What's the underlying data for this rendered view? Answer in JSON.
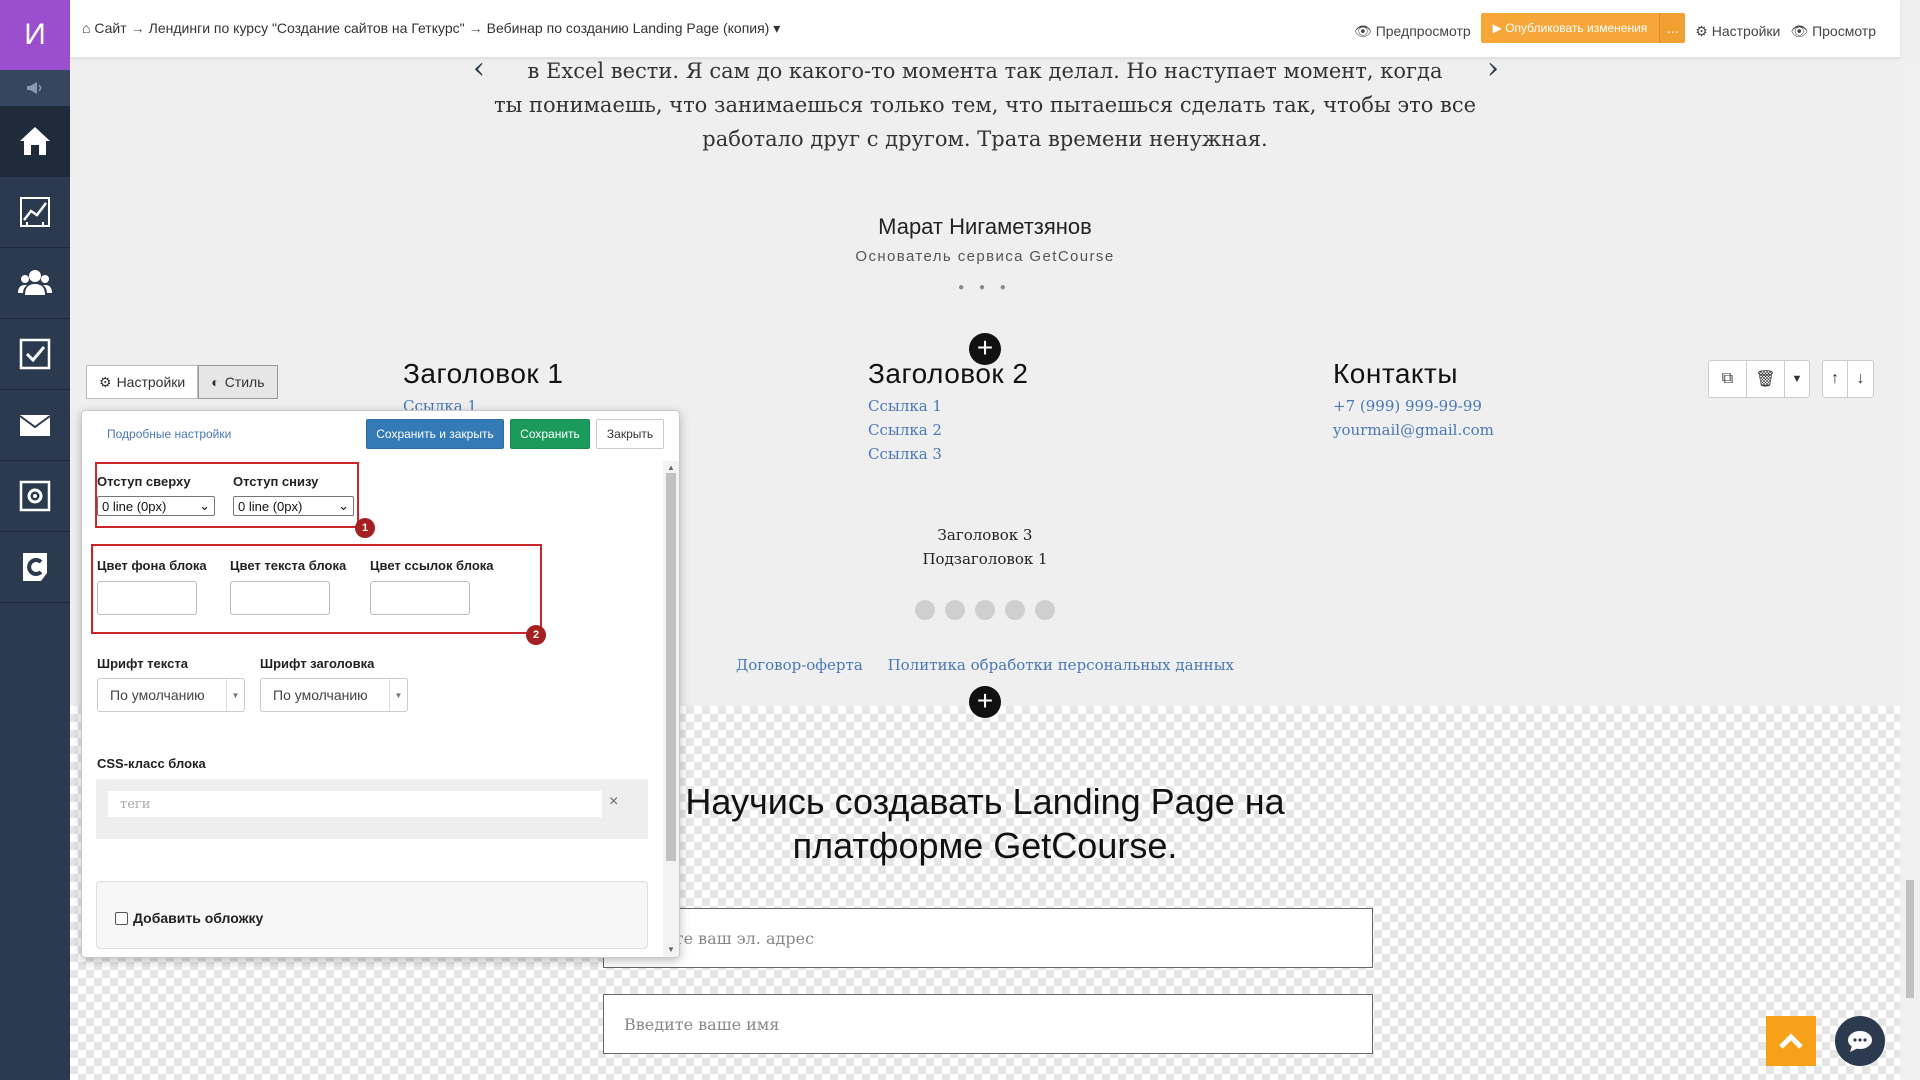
{
  "sidebar": {
    "logo_letter": "И",
    "items": [
      "home",
      "analytics",
      "users",
      "tasks",
      "messages",
      "settings",
      "getcourse"
    ]
  },
  "topbar": {
    "breadcrumb": [
      "Сайт",
      "Лендинги по курсу \"Создание сайтов на Геткурс\"",
      "Вебинар по созданию Landing Page (копия)"
    ],
    "preview": "Предпросмотр",
    "publish": "Опубликовать изменения",
    "publish_more": "...",
    "settings": "Настройки",
    "view": "Просмотр"
  },
  "testimonial": {
    "lines": [
      "в Excel вести. Я сам до какого-то момента так делал. Но наступает момент, когда",
      "ты понимаешь, что занимаешься только тем, что пытаешься сделать так, чтобы это все",
      "работало друг с другом. Трата времени ненужная."
    ],
    "author": "Марат Нигаметзянов",
    "role": "Основатель сервиса GetCourse",
    "dots": "● ● ●"
  },
  "footer": {
    "col1": {
      "title": "Заголовок 1",
      "links": [
        "Ссылка 1"
      ]
    },
    "col2": {
      "title": "Заголовок 2",
      "links": [
        "Ссылка 1",
        "Ссылка 2",
        "Ссылка 3"
      ]
    },
    "col3": {
      "title": "Контакты",
      "links": [
        "+7 (999) 999-99-99",
        "yourmail@gmail.com"
      ]
    },
    "center_title": "Заголовок 3",
    "center_sub": "Подзаголовок 1",
    "legal": [
      "Договор-оферта",
      "Политика обработки персональных данных"
    ]
  },
  "cta": {
    "title_line1": "Научись создавать Landing Page на",
    "title_line2": "платформе GetCourse.",
    "email_placeholder": "Введите ваш эл. адрес",
    "name_placeholder": "Введите ваше имя"
  },
  "panel": {
    "tab_settings": "Настройки",
    "tab_style": "Стиль",
    "advanced_link": "Подробные настройки",
    "save_close": "Сохранить и закрыть",
    "save": "Сохранить",
    "close": "Закрыть",
    "padding_top_label": "Отступ сверху",
    "padding_bottom_label": "Отступ снизу",
    "padding_top_value": "0 line (0px)",
    "padding_bottom_value": "0 line (0px)",
    "bg_color_label": "Цвет фона блока",
    "text_color_label": "Цвет текста блока",
    "link_color_label": "Цвет ссылок блока",
    "text_font_label": "Шрифт текста",
    "title_font_label": "Шрифт заголовка",
    "text_font_value": "По умолчанию",
    "title_font_value": "По умолчанию",
    "css_class_label": "CSS-класс блока",
    "tags_placeholder": "теги",
    "tags_clear": "×",
    "add_cover_label": "Добавить обложку",
    "marker1": "1",
    "marker2": "2"
  },
  "colors": {
    "sidebar_bg": "#2b3a4f",
    "logo_bg": "#9b4fcf",
    "publish_btn": "#f7a738",
    "link": "#4a78b5",
    "save_close_btn": "#337ab7",
    "save_btn": "#1a9b5c",
    "annotation_red": "#c9252b",
    "scroll_up_btn": "#f7a11a"
  }
}
